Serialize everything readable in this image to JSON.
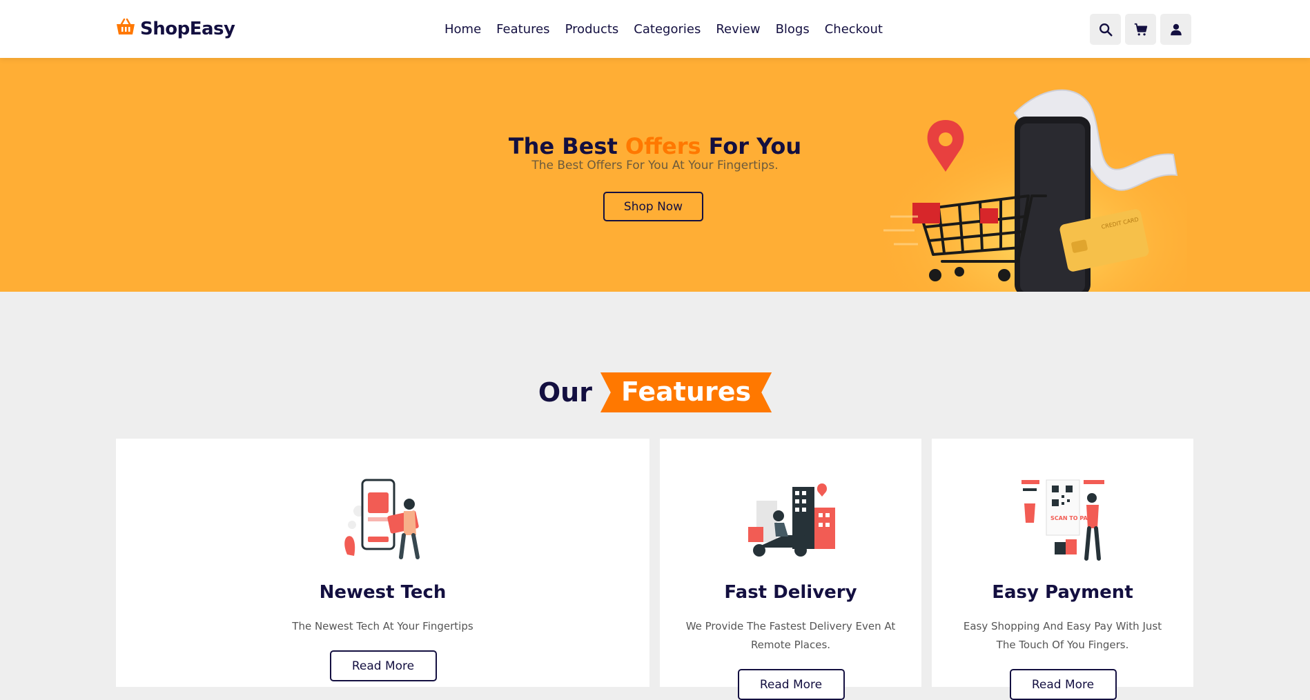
{
  "header": {
    "logo_text": "ShopEasy",
    "nav": [
      "Home",
      "Features",
      "Products",
      "Categories",
      "Review",
      "Blogs",
      "Checkout"
    ],
    "icons": [
      "search-icon",
      "cart-icon",
      "user-icon"
    ]
  },
  "hero": {
    "title_part1": "The Best ",
    "title_accent": "Offers",
    "title_part2": " For You",
    "subtitle": "The Best Offers For You At Your Fingertips.",
    "button": "Shop Now",
    "card_text": "CREDIT CARD"
  },
  "features": {
    "heading_plain": "Our",
    "heading_accent": "Features",
    "cards": [
      {
        "title": "Newest Tech",
        "text": "The Newest Tech At Your Fingertips",
        "button": "Read More"
      },
      {
        "title": "Fast Delivery",
        "text": "We Provide The Fastest Delivery Even At Remote Places.",
        "button": "Read More"
      },
      {
        "title": "Easy Payment",
        "text": "Easy Shopping And Easy Pay With Just The Touch Of You Fingers.",
        "button": "Read More",
        "scan_text": "SCAN TO PAY"
      }
    ]
  },
  "colors": {
    "accent": "#ff7800",
    "hero_bg": "#ffae35",
    "text_dark": "#130f40",
    "page_bg": "#eeeeee"
  }
}
